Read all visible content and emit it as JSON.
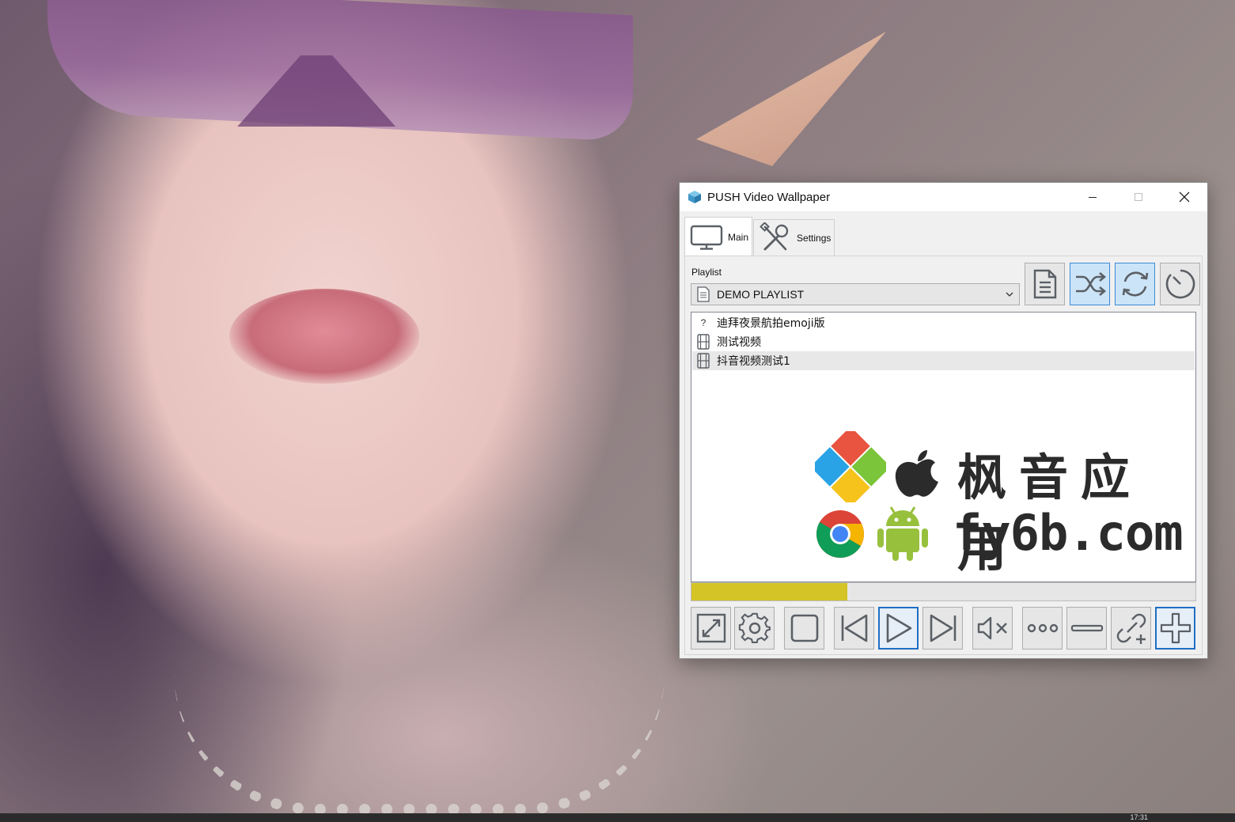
{
  "window": {
    "title": "PUSH Video Wallpaper",
    "caption": {
      "minimize": "minimize",
      "maximize": "maximize",
      "close": "close"
    }
  },
  "tabs": [
    {
      "label": "Main",
      "icon": "monitor-icon",
      "active": true
    },
    {
      "label": "Settings",
      "icon": "tools-icon",
      "active": false
    }
  ],
  "playlist": {
    "label": "Playlist",
    "selected": "DEMO PLAYLIST"
  },
  "toolbar": [
    {
      "name": "playlist-doc-button",
      "icon": "document-icon",
      "active": false
    },
    {
      "name": "shuffle-button",
      "icon": "shuffle-icon",
      "active": true
    },
    {
      "name": "repeat-button",
      "icon": "repeat-icon",
      "active": true
    },
    {
      "name": "timer-button",
      "icon": "timer-icon",
      "active": false
    }
  ],
  "items": [
    {
      "title": "迪拜夜景航拍emoji版",
      "icon": "question-icon",
      "selected": false
    },
    {
      "title": "测试视频",
      "icon": "film-icon",
      "selected": false
    },
    {
      "title": "抖音视频测试1",
      "icon": "film-icon",
      "selected": true
    }
  ],
  "watermark": {
    "cn": "枫音应用",
    "en": "fy6b.com"
  },
  "progress": {
    "value": 0.31,
    "color": "#d4c426"
  },
  "controls": [
    {
      "name": "fullscreen-button",
      "icon": "expand-icon"
    },
    {
      "name": "settings-button",
      "icon": "gear-icon"
    },
    {
      "name": "stop-button",
      "icon": "stop-icon"
    },
    {
      "name": "previous-button",
      "icon": "skip-back-icon"
    },
    {
      "name": "play-button",
      "icon": "play-icon",
      "active": true
    },
    {
      "name": "next-button",
      "icon": "skip-forward-icon"
    },
    {
      "name": "mute-button",
      "icon": "mute-icon"
    },
    {
      "name": "more-button",
      "icon": "more-icon"
    },
    {
      "name": "remove-button",
      "icon": "minus-icon"
    },
    {
      "name": "add-url-button",
      "icon": "link-add-icon"
    },
    {
      "name": "add-button",
      "icon": "plus-icon",
      "active": true
    }
  ],
  "colors": {
    "accent": "#1f6fc4",
    "icon": "#5b6066",
    "toggle_bg": "#cce4f7"
  },
  "taskbar": {
    "clock": "17:31"
  }
}
